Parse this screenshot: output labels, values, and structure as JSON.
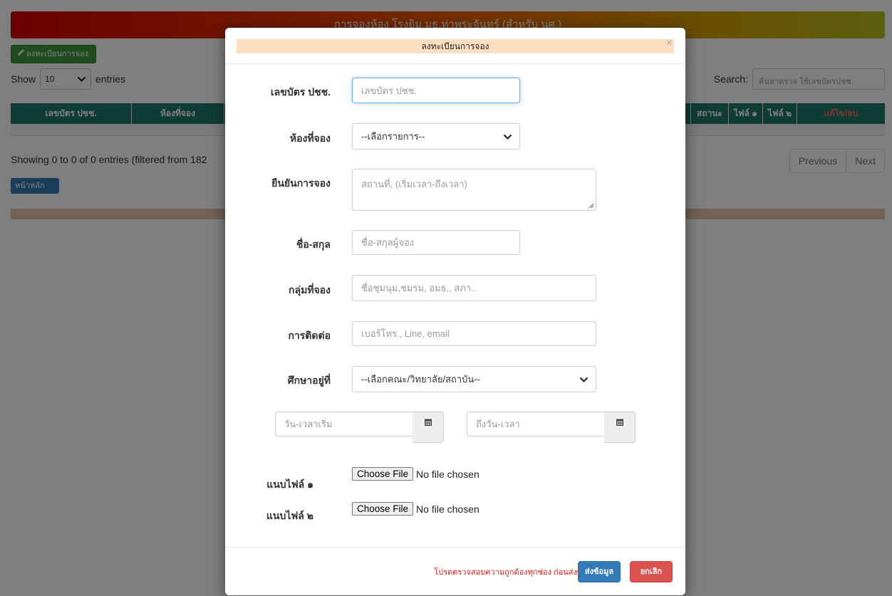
{
  "page": {
    "banner_title": "การจองห้อง โรงยิม มธ.ท่าพระจันทร์ (สำหรับ นศ.)",
    "register_button": "ลงทะเบียนการจอง",
    "show_label": "Show",
    "entries_value": "10",
    "entries_label": "entries",
    "search_label": "Search:",
    "search_placeholder": "ค้นหาตรวจ ใช้เลขบัตรปชช.",
    "table_headers": [
      "เลขบัตร ปชช.",
      "ห้องที่จอง",
      "สถานะ",
      "ไฟล์ ๑",
      "ไฟล์ ๒",
      "แก้ไข/ลบ"
    ],
    "showing_text": "Showing 0 to 0 of 0 entries (filtered from 182",
    "pagination": {
      "previous": "Previous",
      "next": "Next"
    },
    "home_button": "หน้าหลัก"
  },
  "modal": {
    "title": "ลงทะเบียนการจอง",
    "close": "×",
    "fields": {
      "id_card": {
        "label": "เลขบัตร ปชช.",
        "placeholder": "เลขบัตร ปชช."
      },
      "room": {
        "label": "ห้องที่จอง",
        "selected": "--เลือกรายการ--"
      },
      "confirm": {
        "label": "ยืนยันการจอง",
        "placeholder": "สถานที่, (เริ่มเวลา-ถึงเวลา)"
      },
      "name": {
        "label": "ชื่อ-สกุล",
        "placeholder": "ชื่อ-สกุลผู้จอง"
      },
      "group": {
        "label": "กลุ่มที่จอง",
        "placeholder": "ชื่อชุมนุม,ชมรม, อมธ., สภา.."
      },
      "contact": {
        "label": "การติดต่อ",
        "placeholder": "เบอร์โทร., Line, email"
      },
      "faculty": {
        "label": "ศึกษาอยู่ที่",
        "selected": "--เลือกคณะ/วิทยาลัย/สถาบัน--"
      },
      "start_datetime": {
        "placeholder": "วัน-เวลาเริ่ม"
      },
      "end_datetime": {
        "placeholder": "ถึงวัน-เวลา"
      },
      "file1": {
        "label": "แนบไฟล์ ๑",
        "button": "Choose File",
        "status": "No file chosen"
      },
      "file2": {
        "label": "แนบไฟล์ ๒",
        "button": "Choose File",
        "status": "No file chosen"
      }
    },
    "footer": {
      "warning": "โปรดตรวจสอบความถูกต้องทุกช่อง ก่อนส่งข้อมูล",
      "submit": "ส่งข้อมูล",
      "cancel": "ยกเลิก"
    }
  },
  "colors": {
    "banner_start": "#d40000",
    "banner_end": "#b8c020",
    "table_header": "#1f7a6b",
    "modal_title_bg": "#fcdfc0",
    "submit": "#337ab7",
    "cancel": "#d9534f",
    "warning_text": "#e02020"
  },
  "icons": [
    "pencil-icon",
    "chevron-down-icon",
    "calendar-icon",
    "close-icon",
    "sort-icon"
  ]
}
